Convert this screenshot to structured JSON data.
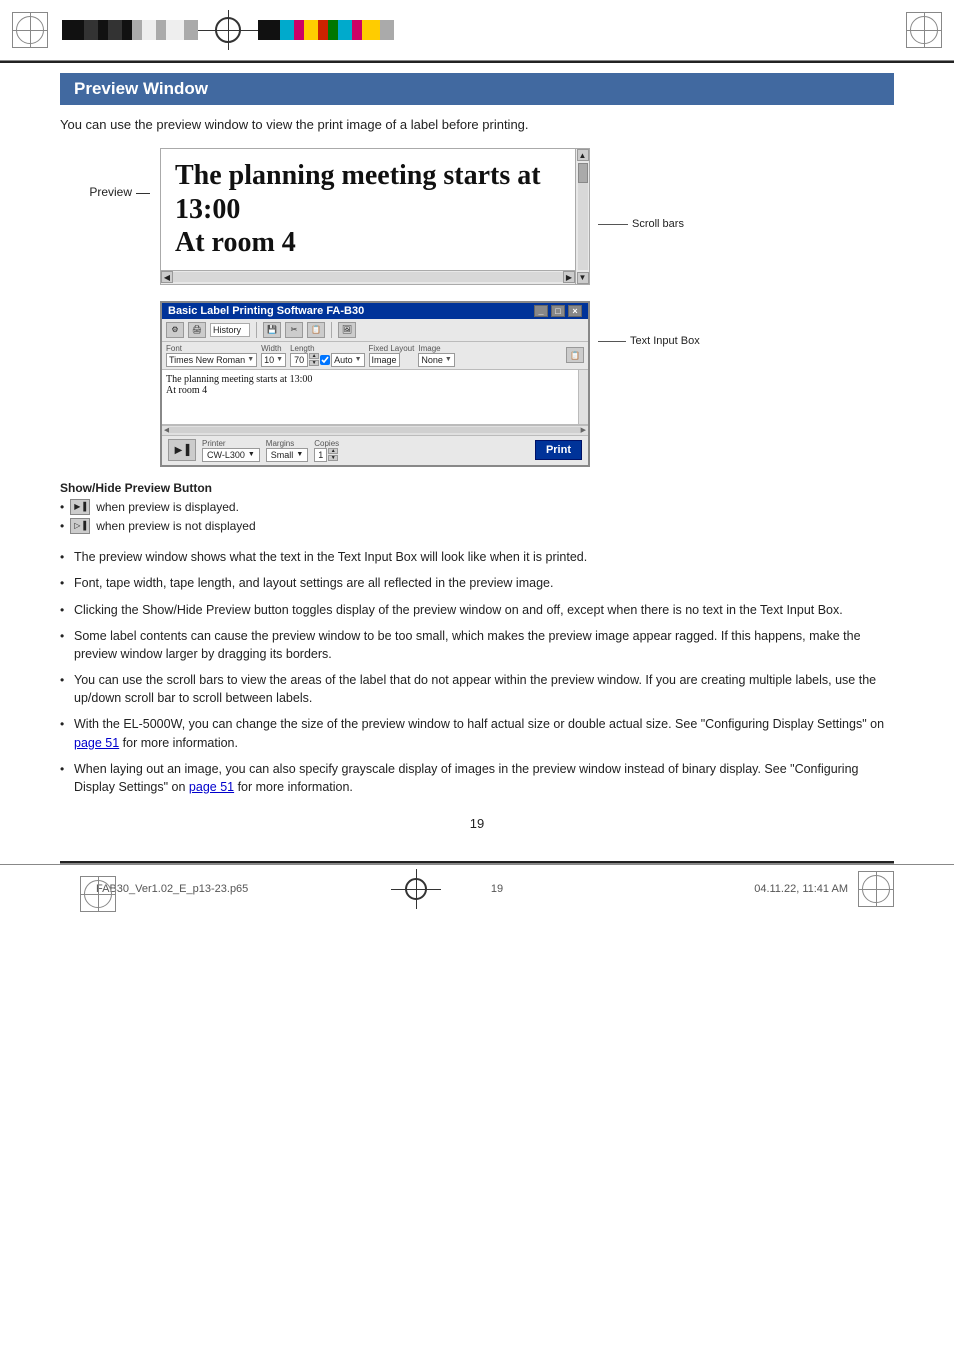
{
  "page": {
    "number": "19",
    "footer_left": "FAB30_Ver1.02_E_p13-23.p65",
    "footer_center": "19",
    "footer_right": "04.11.22, 11:41 AM"
  },
  "header": {
    "section_title": "Preview Window"
  },
  "intro": {
    "text": "You can use the preview window to view the print image of a label before printing."
  },
  "preview": {
    "label": "Preview",
    "preview_text_line1": "The planning meeting starts at 13:00",
    "preview_text_line2": "At room 4"
  },
  "annotations": {
    "scroll_bars": "Scroll bars",
    "text_input_box": "Text Input Box"
  },
  "software_window": {
    "title": "Basic Label Printing Software FA-B30",
    "fields": {
      "font_label": "Font",
      "font_value": "Times New Roman",
      "width_label": "Width",
      "width_value": "10",
      "length_label": "Length",
      "length_value": "70",
      "fixed_layout_label": "Fixed Layout",
      "image_label": "Image",
      "image_value": "None"
    },
    "text_content_line1": "The planning meeting starts at 13:00",
    "text_content_line2": "At room 4",
    "bottom": {
      "printer_label": "Printer",
      "printer_value": "CW-L300",
      "margins_label": "Margins",
      "margins_value": "Small",
      "copies_label": "Copies",
      "copies_value": "1",
      "print_btn": "Print"
    }
  },
  "show_hide": {
    "title": "Show/Hide Preview Button",
    "item1": "when preview is displayed.",
    "item2": "when preview is not displayed"
  },
  "bullets": [
    "The preview window shows what the text in the Text Input Box will look like when it is printed.",
    "Font, tape width, tape length, and layout settings are all reflected in the preview image.",
    "Clicking the Show/Hide Preview button toggles display of the preview window on and off, except when there is no text in the Text Input Box.",
    "Some label contents can cause the preview window to be too small, which makes the preview image appear ragged. If this happens, make the preview window larger by dragging its borders.",
    "You can use the scroll bars to view the areas of the label that do not appear within the preview window. If you are creating multiple labels, use the up/down scroll bar to scroll between labels.",
    "With the EL-5000W, you can change the size of the preview window to half actual size or double actual size. See “Configuring Display Settings” on page 51 for more information.",
    "When laying out an image, you can also specify grayscale display of images in the preview window instead of binary display.  See “Configuring Display Settings” on page 51 for more information."
  ],
  "bullet_links": {
    "bullet6_link": "page 51",
    "bullet7_link": "page 51"
  }
}
